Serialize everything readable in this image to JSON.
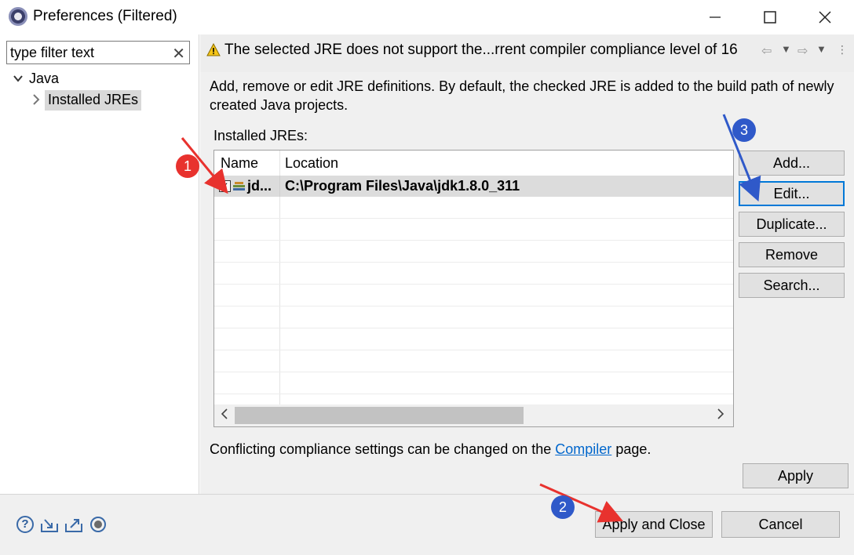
{
  "window": {
    "title": "Preferences (Filtered)",
    "minimize_glyph": "—",
    "maximize_glyph": "☐",
    "close_glyph": "✕"
  },
  "sidebar": {
    "filter": {
      "value": "type filter text",
      "placeholder": "type filter text",
      "clear_glyph": "✕"
    },
    "tree": [
      {
        "label": "Java",
        "expanded": true,
        "glyph": "⌄"
      },
      {
        "label": "Installed JREs",
        "selected": true,
        "glyph": "›"
      }
    ]
  },
  "header": {
    "warning_icon": "⚠",
    "message": "The selected JRE does not support the...rrent compiler compliance level of 16",
    "nav": {
      "back": "⇦",
      "back_dropdown": "▼",
      "forward": "⇨",
      "forward_dropdown": "▼",
      "menu": "⋮"
    }
  },
  "main": {
    "description": "Add, remove or edit JRE definitions. By default, the checked JRE is added to the build path of newly created Java projects.",
    "table_label": "Installed JREs:",
    "columns": [
      "Name",
      "Location"
    ],
    "rows": [
      {
        "checked": true,
        "check_glyph": "✓",
        "name": "jd...",
        "location": "C:\\Program Files\\Java\\jdk1.8.0_311"
      }
    ],
    "scroll": {
      "left": "‹",
      "right": "›"
    },
    "buttons": {
      "add": "Add...",
      "edit": "Edit...",
      "duplicate": "Duplicate...",
      "remove": "Remove",
      "search": "Search..."
    },
    "conflict_prefix": "Conflicting compliance settings can be changed on the ",
    "conflict_link": "Compiler",
    "conflict_suffix": " page.",
    "apply": "Apply"
  },
  "footer": {
    "help_glyph": "?",
    "apply_close": "Apply and Close",
    "cancel": "Cancel"
  },
  "annotations": {
    "badge1": "1",
    "badge2": "2",
    "badge3": "3"
  },
  "colors": {
    "accent": "#0078d7",
    "red_marker": "#e8322e",
    "blue_marker": "#2f59c9",
    "link": "#0066cc"
  }
}
